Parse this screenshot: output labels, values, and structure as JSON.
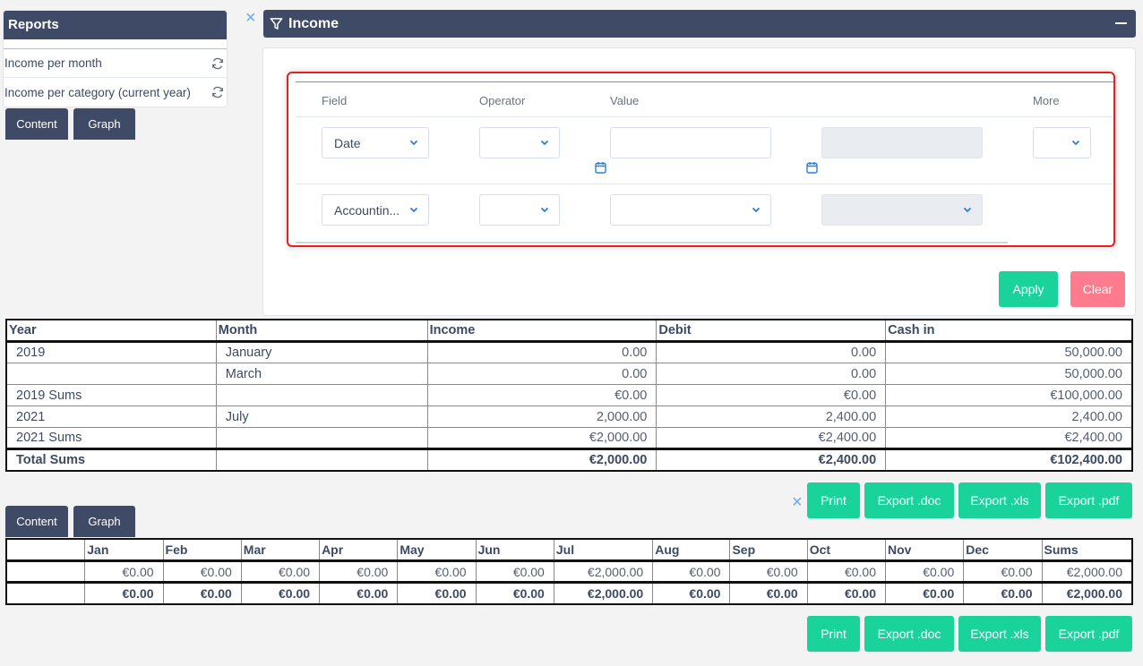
{
  "sidebar": {
    "title": "Reports",
    "items": [
      {
        "label": "Income per month",
        "icon": "refresh-icon"
      },
      {
        "label": "Income per category (current year)",
        "icon": "refresh-icon"
      }
    ],
    "tabs": [
      "Content",
      "Graph"
    ]
  },
  "panel": {
    "title": "Income",
    "icon": "filter-icon",
    "close": "×"
  },
  "filter": {
    "columns": {
      "field": "Field",
      "operator": "Operator",
      "value": "Value",
      "more": "More"
    },
    "rows": [
      {
        "field": "Date",
        "operator": "",
        "value": "",
        "value2": "",
        "more": ""
      },
      {
        "field": "Accountin...",
        "operator": "",
        "value": "",
        "value2": ""
      }
    ],
    "apply_label": "Apply",
    "clear_label": "Clear"
  },
  "report_table": {
    "headers": [
      "Year",
      "Month",
      "Income",
      "Debit",
      "Cash in"
    ],
    "rows": [
      {
        "year": "2019",
        "month": "January",
        "income": "0.00",
        "debit": "0.00",
        "cash_in": "50,000.00"
      },
      {
        "year": "",
        "month": "March",
        "income": "0.00",
        "debit": "0.00",
        "cash_in": "50,000.00"
      },
      {
        "year": "2019 Sums",
        "month": "",
        "income": "€0.00",
        "debit": "€0.00",
        "cash_in": "€100,000.00"
      },
      {
        "year": "2021",
        "month": "July",
        "income": "2,000.00",
        "debit": "2,400.00",
        "cash_in": "2,400.00"
      },
      {
        "year": "2021 Sums",
        "month": "",
        "income": "€2,000.00",
        "debit": "€2,400.00",
        "cash_in": "€2,400.00"
      }
    ],
    "total": {
      "year": "Total Sums",
      "month": "",
      "income": "€2,000.00",
      "debit": "€2,400.00",
      "cash_in": "€102,400.00"
    }
  },
  "actions": {
    "close": "×",
    "print": "Print",
    "export_doc": "Export .doc",
    "export_xls": "Export .xls",
    "export_pdf": "Export .pdf"
  },
  "tabs2": [
    "Content",
    "Graph"
  ],
  "monthly_table": {
    "headers": [
      "",
      "Jan",
      "Feb",
      "Mar",
      "Apr",
      "May",
      "Jun",
      "Jul",
      "Aug",
      "Sep",
      "Oct",
      "Nov",
      "Dec",
      "Sums"
    ],
    "row": [
      "",
      "€0.00",
      "€0.00",
      "€0.00",
      "€0.00",
      "€0.00",
      "€0.00",
      "€2,000.00",
      "€0.00",
      "€0.00",
      "€0.00",
      "€0.00",
      "€0.00",
      "€2,000.00"
    ],
    "total": [
      "",
      "€0.00",
      "€0.00",
      "€0.00",
      "€0.00",
      "€0.00",
      "€0.00",
      "€2,000.00",
      "€0.00",
      "€0.00",
      "€0.00",
      "€0.00",
      "€0.00",
      "€2,000.00"
    ]
  },
  "colors": {
    "header_bg": "#3f4b66",
    "accent_green": "#19d39b",
    "accent_pink": "#fd7b8c",
    "highlight_red": "#ee1c1c",
    "icon_blue": "#2b7de0"
  }
}
